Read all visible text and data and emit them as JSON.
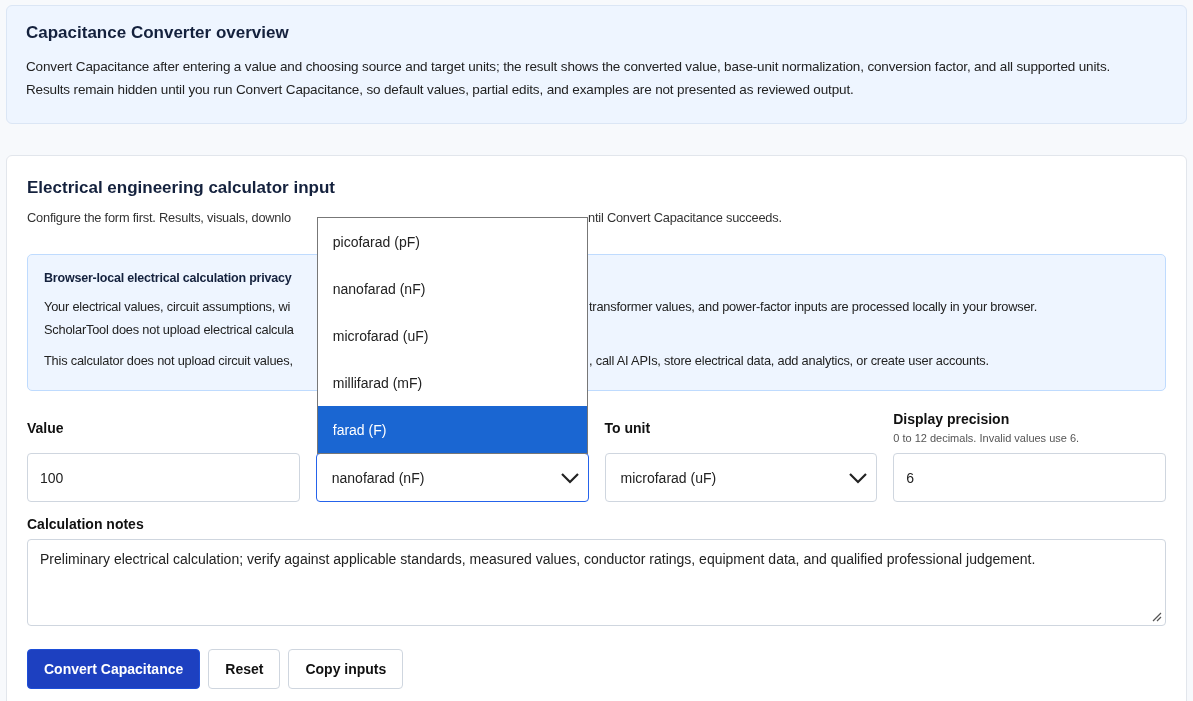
{
  "overview": {
    "title": "Capacitance Converter overview",
    "lines": [
      "Convert Capacitance after entering a value and choosing source and target units; the result shows the converted value, base-unit normalization, conversion factor, and all supported units.",
      "Results remain hidden until you run Convert Capacitance, so default values, partial edits, and examples are not presented as reviewed output."
    ]
  },
  "input_card": {
    "title": "Electrical engineering calculator input",
    "subtitle": {
      "left": "Configure the form first. Results, visuals, downlo",
      "right": "ntil Convert Capacitance succeeds."
    },
    "privacy": {
      "title": "Browser-local electrical calculation privacy",
      "lines": [
        {
          "left": "Your electrical values, circuit assumptions, wi",
          "right": "transformer values, and power-factor inputs are processed locally in your browser."
        },
        {
          "left": "ScholarTool does not upload electrical calcula"
        },
        {
          "left": "This calculator does not upload circuit values,",
          "right": ", call AI APIs, store electrical data, add analytics, or create user accounts."
        }
      ]
    },
    "fields": [
      {
        "kind": "text",
        "label": "Value",
        "value": "100"
      },
      {
        "kind": "select",
        "value": "nanofarad (nF)",
        "focused": true,
        "open": true,
        "options": [
          {
            "label": "picofarad (pF)",
            "highlighted": false
          },
          {
            "label": "nanofarad (nF)",
            "highlighted": false
          },
          {
            "label": "microfarad (uF)",
            "highlighted": false
          },
          {
            "label": "millifarad (mF)",
            "highlighted": false
          },
          {
            "label": "farad (F)",
            "highlighted": true
          }
        ]
      },
      {
        "kind": "select",
        "label": "To unit",
        "value": "microfarad (uF)",
        "focused": false
      },
      {
        "kind": "text",
        "label": "Display precision",
        "hint": "0 to 12 decimals. Invalid values use 6.",
        "value": "6"
      }
    ],
    "notes": {
      "label": "Calculation notes",
      "value": "Preliminary electrical calculation; verify against applicable standards, measured values, conductor ratings, equipment data, and qualified professional judgement."
    },
    "buttons": [
      {
        "kind": "primary",
        "label": "Convert Capacitance"
      },
      {
        "kind": "secondary",
        "label": "Reset"
      },
      {
        "kind": "secondary",
        "label": "Copy inputs"
      }
    ]
  }
}
